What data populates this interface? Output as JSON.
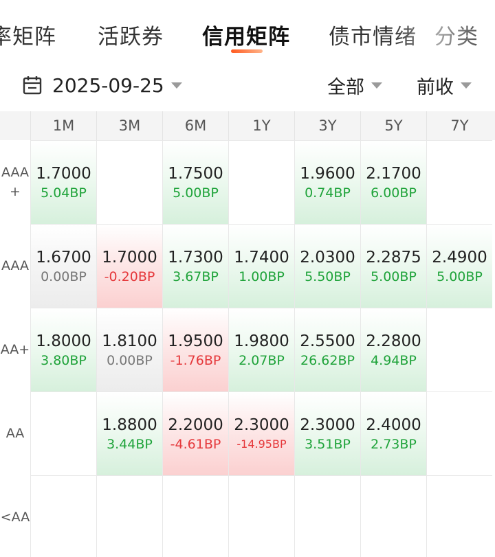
{
  "tabs": [
    {
      "label": "率矩阵",
      "active": false
    },
    {
      "label": "活跃券",
      "active": false
    },
    {
      "label": "信用矩阵",
      "active": true
    },
    {
      "label": "债市情绪",
      "active": false
    },
    {
      "label": "分类",
      "active": false
    }
  ],
  "filters": {
    "date": "2025-09-25",
    "scope": "全部",
    "price_type": "前收"
  },
  "colors": {
    "up": "#1fa33a",
    "down": "#e5383b",
    "accent": "#ff5a1f"
  },
  "matrix": {
    "columns": [
      "1M",
      "3M",
      "6M",
      "1Y",
      "3Y",
      "5Y",
      "7Y"
    ],
    "rows": [
      {
        "label": "AAA\n+",
        "cells": [
          {
            "val": "1.7000",
            "bp": "5.04BP",
            "tone": "up"
          },
          null,
          {
            "val": "1.7500",
            "bp": "5.00BP",
            "tone": "up"
          },
          null,
          {
            "val": "1.9600",
            "bp": "0.74BP",
            "tone": "up"
          },
          {
            "val": "2.1700",
            "bp": "6.00BP",
            "tone": "up"
          },
          null
        ]
      },
      {
        "label": "AAA",
        "cells": [
          {
            "val": "1.6700",
            "bp": "0.00BP",
            "tone": "flat"
          },
          {
            "val": "1.7000",
            "bp": "-0.20BP",
            "tone": "down"
          },
          {
            "val": "1.7300",
            "bp": "3.67BP",
            "tone": "up"
          },
          {
            "val": "1.7400",
            "bp": "1.00BP",
            "tone": "up"
          },
          {
            "val": "2.0300",
            "bp": "5.50BP",
            "tone": "up"
          },
          {
            "val": "2.2875",
            "bp": "5.00BP",
            "tone": "up"
          },
          {
            "val": "2.4900",
            "bp": "5.00BP",
            "tone": "up"
          }
        ]
      },
      {
        "label": "AA+",
        "cells": [
          {
            "val": "1.8000",
            "bp": "3.80BP",
            "tone": "up"
          },
          {
            "val": "1.8100",
            "bp": "0.00BP",
            "tone": "flat"
          },
          {
            "val": "1.9500",
            "bp": "-1.76BP",
            "tone": "down"
          },
          {
            "val": "1.9800",
            "bp": "2.07BP",
            "tone": "up"
          },
          {
            "val": "2.5500",
            "bp": "26.62BP",
            "tone": "up"
          },
          {
            "val": "2.2800",
            "bp": "4.94BP",
            "tone": "up"
          },
          null
        ]
      },
      {
        "label": "AA",
        "cells": [
          null,
          {
            "val": "1.8800",
            "bp": "3.44BP",
            "tone": "up"
          },
          {
            "val": "2.2000",
            "bp": "-4.61BP",
            "tone": "down"
          },
          {
            "val": "2.3000",
            "bp": "-14.95BP",
            "tone": "down"
          },
          {
            "val": "2.3000",
            "bp": "3.51BP",
            "tone": "up"
          },
          {
            "val": "2.4000",
            "bp": "2.73BP",
            "tone": "up"
          },
          null
        ]
      },
      {
        "label": "<AA",
        "cells": [
          null,
          null,
          null,
          null,
          null,
          null,
          null
        ]
      }
    ]
  }
}
